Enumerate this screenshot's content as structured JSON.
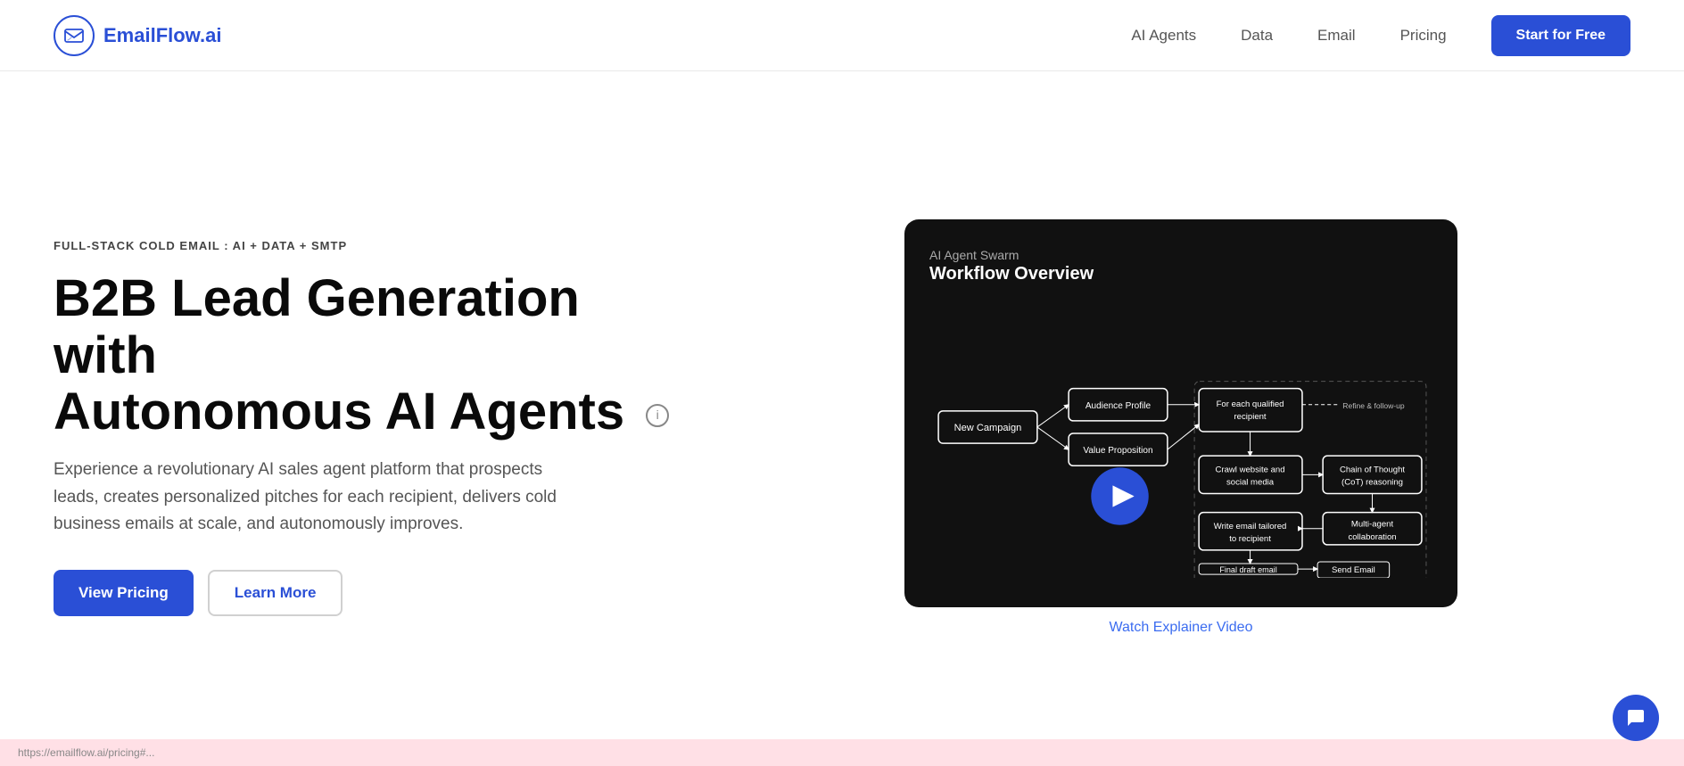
{
  "nav": {
    "logo_text": "EmailFlow.ai",
    "links": [
      {
        "label": "AI Agents",
        "id": "ai-agents"
      },
      {
        "label": "Data",
        "id": "data"
      },
      {
        "label": "Email",
        "id": "email"
      },
      {
        "label": "Pricing",
        "id": "pricing"
      }
    ],
    "cta_label": "Start for Free"
  },
  "hero": {
    "eyebrow": "FULL-STACK COLD EMAIL : AI + DATA + SMTP",
    "title_line1": "B2B Lead Generation with",
    "title_line2": "Autonomous AI Agents",
    "description": "Experience a revolutionary AI sales agent platform that prospects leads, creates personalized pitches for each recipient, delivers cold business emails at scale, and autonomously improves.",
    "btn_primary": "View Pricing",
    "btn_secondary": "Learn More",
    "diagram_label": "AI Agent Swarm",
    "diagram_title": "Workflow Overview",
    "watch_link": "Watch Explainer Video",
    "flow_nodes": [
      {
        "id": "new-campaign",
        "label": "New Campaign"
      },
      {
        "id": "audience-profile",
        "label": "Audience Profile"
      },
      {
        "id": "value-proposition",
        "label": "Value Proposition"
      },
      {
        "id": "for-each",
        "label": "For each qualified recipient"
      },
      {
        "id": "crawl",
        "label": "Crawl website and social media"
      },
      {
        "id": "chain-of-thought",
        "label": "Chain of Thought (CoT) reasoning"
      },
      {
        "id": "write-email",
        "label": "Write email tailored to recipient"
      },
      {
        "id": "multi-agent",
        "label": "Multi-agent collaboration"
      },
      {
        "id": "final-draft",
        "label": "Final draft email"
      },
      {
        "id": "send-email",
        "label": "Send Email"
      },
      {
        "id": "refine",
        "label": "Refine & follow-up"
      }
    ]
  },
  "chat": {
    "icon": "chat-icon"
  },
  "bottom_bar": {
    "text": "https://emailflow.ai/pricing#..."
  }
}
